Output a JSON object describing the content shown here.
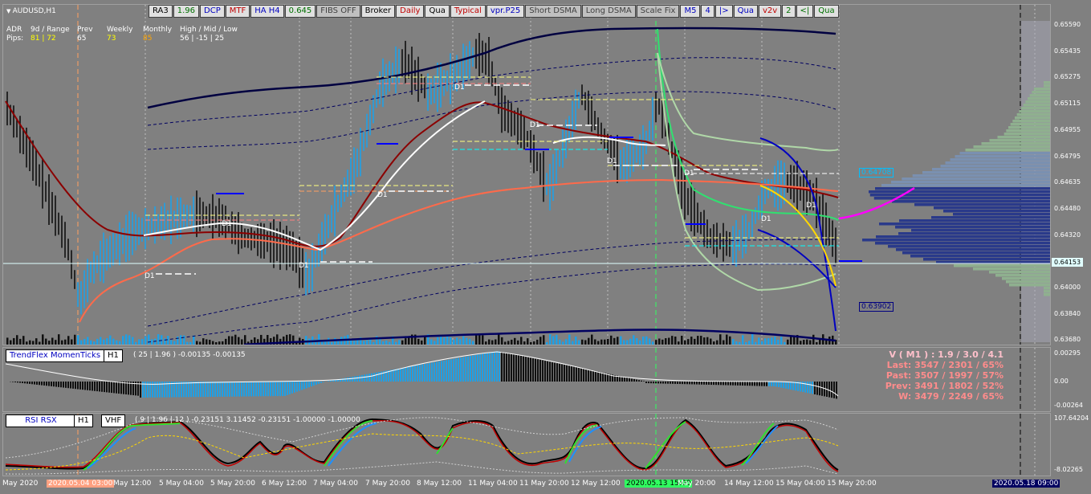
{
  "symbol": "AUDUSD,H1",
  "toolbar": [
    {
      "label": "RA3",
      "bg": "#e0e0e0",
      "fg": "#000"
    },
    {
      "label": "1.96",
      "bg": "#e0e0e0",
      "fg": "#007000"
    },
    {
      "label": "DCP",
      "bg": "#e0e0e0",
      "fg": "#0000c0"
    },
    {
      "label": "MTF",
      "bg": "#e0e0e0",
      "fg": "#c00000"
    },
    {
      "label": "HA H4",
      "bg": "#e0e0e0",
      "fg": "#0000c0"
    },
    {
      "label": "0.645",
      "bg": "#e0e0e0",
      "fg": "#007000"
    },
    {
      "label": "FIBS OFF",
      "bg": "#c0c0c0",
      "fg": "#404040"
    },
    {
      "label": "Broker",
      "bg": "#e0e0e0",
      "fg": "#000"
    },
    {
      "label": "Daily",
      "bg": "#e0e0e0",
      "fg": "#c00000"
    },
    {
      "label": "Qua",
      "bg": "#e0e0e0",
      "fg": "#000"
    },
    {
      "label": "Typical",
      "bg": "#e0e0e0",
      "fg": "#c00000"
    },
    {
      "label": "vpr.P25",
      "bg": "#e0e0e0",
      "fg": "#0000c0"
    },
    {
      "label": "Short DSMA",
      "bg": "#c0c0c0",
      "fg": "#404040"
    },
    {
      "label": "Long DSMA",
      "bg": "#c0c0c0",
      "fg": "#404040"
    },
    {
      "label": "Scale Fix",
      "bg": "#c0c0c0",
      "fg": "#404040"
    },
    {
      "label": "M5",
      "bg": "#e0e0e0",
      "fg": "#0000c0"
    },
    {
      "label": "4",
      "bg": "#e0e0e0",
      "fg": "#0000c0"
    },
    {
      "label": "|>",
      "bg": "#e0e0e0",
      "fg": "#0000c0"
    },
    {
      "label": "Qua",
      "bg": "#e0e0e0",
      "fg": "#0000c0"
    },
    {
      "label": "v2v",
      "bg": "#e0e0e0",
      "fg": "#c00000"
    },
    {
      "label": "2",
      "bg": "#e0e0e0",
      "fg": "#007000"
    },
    {
      "label": "<|",
      "bg": "#e0e0e0",
      "fg": "#007000"
    },
    {
      "label": "Qua",
      "bg": "#e0e0e0",
      "fg": "#007000"
    }
  ],
  "adr": {
    "label": "ADR",
    "pips_label": "Pips:",
    "cols": [
      {
        "head": "9d / Range",
        "val": "81 | 72",
        "color": "#ffff00"
      },
      {
        "head": "Prev",
        "val": "65",
        "color": "#ffffff"
      },
      {
        "head": "Weekly",
        "val": "73",
        "color": "#ffff00"
      },
      {
        "head": "Monthly",
        "val": "85",
        "color": "#ffa500"
      },
      {
        "head": "High / Mid / Low",
        "val": "56 | -15 | 25",
        "color": "#ffffff"
      }
    ]
  },
  "price_axis": [
    "0.65590",
    "0.65435",
    "0.65275",
    "0.65115",
    "0.64955",
    "0.64795",
    "0.64635",
    "0.64480",
    "0.64320",
    "0.64160",
    "0.64000",
    "0.63840",
    "0.63680"
  ],
  "current_price": "0.64153",
  "price_markers": [
    {
      "label": "0.64708",
      "color": "#00bfff"
    },
    {
      "label": "0.63902",
      "color": "#000080"
    }
  ],
  "time_axis": [
    "May 2020",
    "2020.05.04 03:00",
    "May 12:00",
    "5 May 04:00",
    "5 May 20:00",
    "6 May 12:00",
    "7 May 04:00",
    "7 May 20:00",
    "8 May 12:00",
    "11 May 04:00",
    "11 May 20:00",
    "12 May 12:00",
    "2020.05.13 15:00",
    "May 20:00",
    "14 May 12:00",
    "15 May 04:00",
    "15 May 20:00",
    "2020.05.18 09:00"
  ],
  "d1_tags": [
    "D1",
    "D1",
    "D1",
    "D1",
    "D1",
    "D1",
    "D1",
    "D1",
    "D1",
    "D1"
  ],
  "trendflex": {
    "title": "TrendFlex MomenTicks",
    "tf": "H1",
    "params": "( 25 | 1.96 ) -0.00135 -0.00135",
    "axis": [
      "0.00295",
      "0.00",
      "-0.00264"
    ]
  },
  "stats": {
    "title": "V ( M1 ) : 1.9 / 3.0 / 4.1",
    "rows": [
      "Last: 3547 / 2301 / 65%",
      "Past: 3507 / 1997 / 57%",
      "Prev: 3491 / 1802 / 52%",
      "W: 3479 / 2249 / 65%"
    ]
  },
  "rsi": {
    "title": "RSI RSX",
    "tf": "H1",
    "mode": "VHF",
    "params": "( 9 | 1.96 | 12 ) -0.23151 3.11452 -0.23151 -1.00000 -1.00000",
    "axis": [
      "107.64204",
      "-8.02265"
    ]
  }
}
